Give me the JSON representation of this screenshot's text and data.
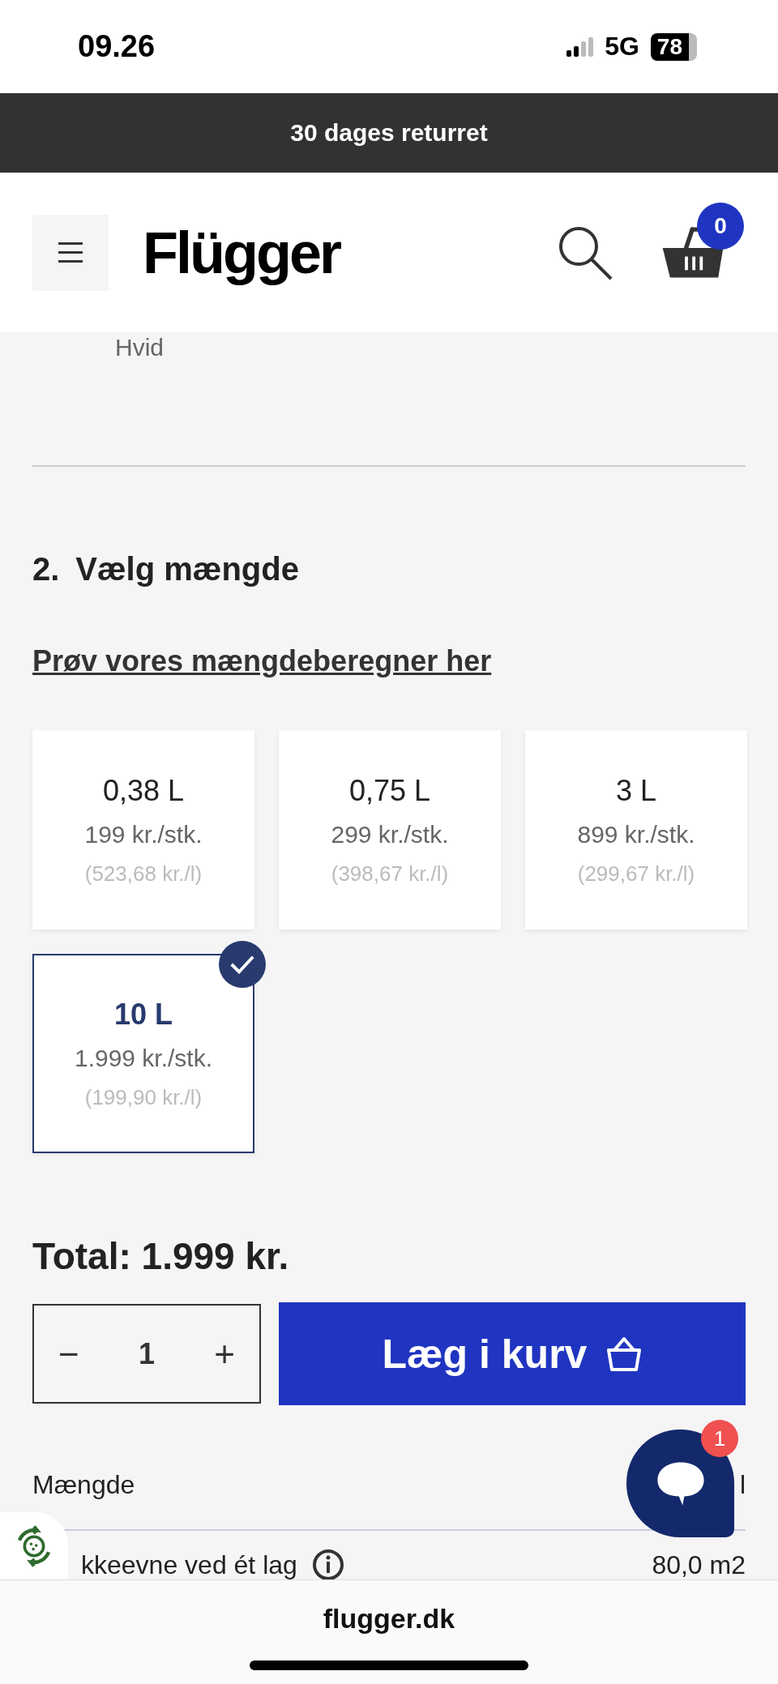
{
  "status_bar": {
    "time": "09.26",
    "network": "5G",
    "battery": "78"
  },
  "banner": {
    "text": "30 dages returret"
  },
  "header": {
    "logo": "Flügger",
    "cart_count": "0"
  },
  "color_name": "Hvid",
  "step": {
    "number": "2.",
    "title": "Vælg mængde"
  },
  "calculator_link": "Prøv vores mængdeberegner her",
  "options": [
    {
      "size": "0,38 L",
      "price": "199 kr./stk.",
      "unit_price": "(523,68 kr./l)",
      "selected": false
    },
    {
      "size": "0,75 L",
      "price": "299 kr./stk.",
      "unit_price": "(398,67 kr./l)",
      "selected": false
    },
    {
      "size": "3 L",
      "price": "899 kr./stk.",
      "unit_price": "(299,67 kr./l)",
      "selected": false
    },
    {
      "size": "10 L",
      "price": "1.999 kr./stk.",
      "unit_price": "(199,90 kr./l)",
      "selected": true
    }
  ],
  "total": "Total: 1.999 kr.",
  "quantity": {
    "minus": "−",
    "value": "1",
    "plus": "+"
  },
  "add_to_cart": "Læg i kurv",
  "specs": [
    {
      "label": "Mængde",
      "value": "l"
    },
    {
      "label": "kkeevne ved ét lag",
      "value": "80,0 m2"
    }
  ],
  "chat": {
    "badge": "1"
  },
  "browser": {
    "url": "flugger.dk"
  }
}
